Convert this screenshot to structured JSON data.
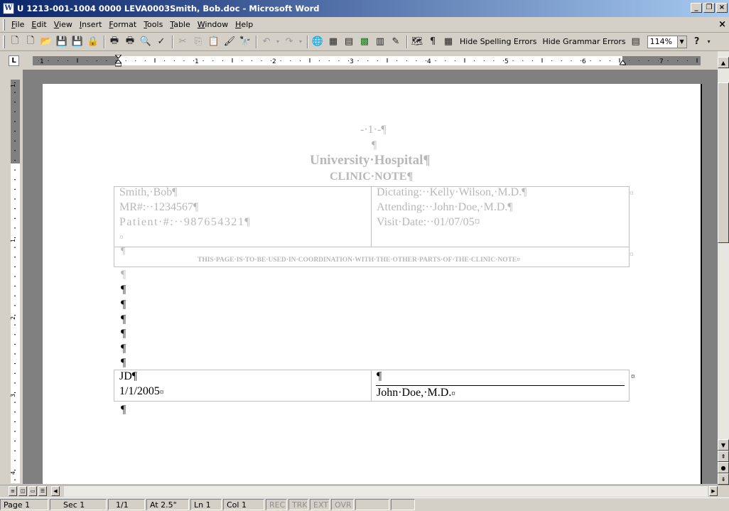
{
  "window": {
    "title": "U 1213-001-1004 0000 LEVA0003Smith, Bob.doc - Microsoft Word",
    "app_icon": "W",
    "minimize": "_",
    "restore": "❐",
    "close": "×"
  },
  "menu": {
    "items": [
      "File",
      "Edit",
      "View",
      "Insert",
      "Format",
      "Tools",
      "Table",
      "Window",
      "Help"
    ],
    "doc_close": "×"
  },
  "toolbar": {
    "hide_spelling": "Hide Spelling Errors",
    "hide_grammar": "Hide Grammar Errors",
    "zoom": "114%",
    "icons": [
      "new-icon",
      "new-blank-icon",
      "open-icon",
      "save-icon",
      "save-all-icon",
      "permission-icon",
      "print-icon",
      "print-icon-2",
      "print-preview-icon",
      "spelling-icon",
      "cut-icon",
      "copy-icon",
      "paste-icon",
      "format-painter-icon",
      "find-icon",
      "undo-icon",
      "redo-icon",
      "hyperlink-icon",
      "tables-borders-icon",
      "insert-table-icon",
      "insert-excel-icon",
      "columns-icon",
      "drawing-icon",
      "document-map-icon",
      "show-hide-icon",
      "gridlines-icon"
    ]
  },
  "ruler": {
    "tab_selector": "L",
    "numbers": [
      "1",
      "1",
      "2",
      "3",
      "4",
      "5",
      "6",
      "7"
    ]
  },
  "document": {
    "page_number": "-·1·-¶",
    "blank_para": "¶",
    "hospital": "University·Hospital¶",
    "clinic_note": "CLINIC·NOTE¶",
    "patient_name": "Smith,·Bob¶",
    "mr_number": "MR#:··1234567¶",
    "patient_number": "Patient·#:··987654321¶",
    "cell_end": "¤",
    "dictating": "Dictating:··Kelly·Wilson,·M.D.¶",
    "attending": "Attending:··John·Doe,·M.D.¶",
    "visit_date": "Visit·Date:··01/07/05¤",
    "coordination_note": "THIS·PAGE·IS·TO·BE·USED·IN·COORDINATION·WITH·THE·OTHER·PARTS·OF·THE·CLINIC·NOTE¤",
    "pilcrow": "¶",
    "initials": "JD¶",
    "sign_date": "1/1/2005",
    "signature_name": "John·Doe,·M.D."
  },
  "statusbar": {
    "page": "Page  1",
    "sec": "Sec  1",
    "of": "1/1",
    "at": "At  2.5\"",
    "ln": "Ln  1",
    "col": "Col  1",
    "rec": "REC",
    "trk": "TRK",
    "ext": "EXT",
    "ovr": "OVR"
  }
}
